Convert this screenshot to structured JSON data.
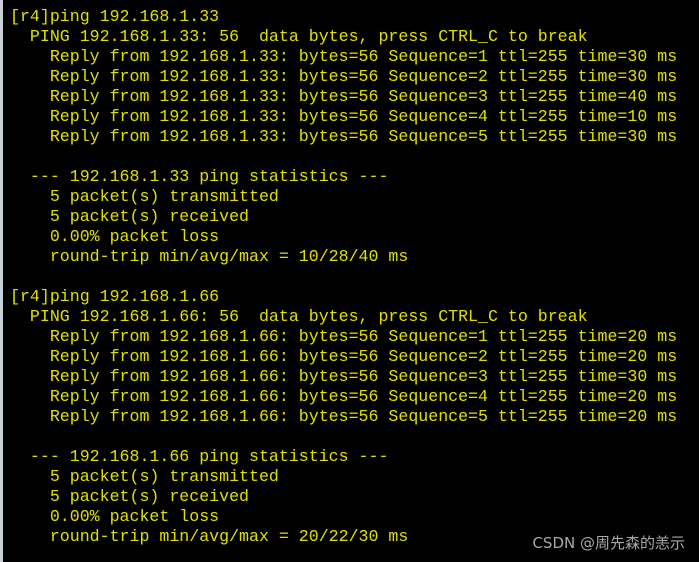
{
  "terminal": {
    "lines": [
      "[r4]ping 192.168.1.33",
      "  PING 192.168.1.33: 56  data bytes, press CTRL_C to break",
      "    Reply from 192.168.1.33: bytes=56 Sequence=1 ttl=255 time=30 ms",
      "    Reply from 192.168.1.33: bytes=56 Sequence=2 ttl=255 time=30 ms",
      "    Reply from 192.168.1.33: bytes=56 Sequence=3 ttl=255 time=40 ms",
      "    Reply from 192.168.1.33: bytes=56 Sequence=4 ttl=255 time=10 ms",
      "    Reply from 192.168.1.33: bytes=56 Sequence=5 ttl=255 time=30 ms",
      "",
      "  --- 192.168.1.33 ping statistics ---",
      "    5 packet(s) transmitted",
      "    5 packet(s) received",
      "    0.00% packet loss",
      "    round-trip min/avg/max = 10/28/40 ms",
      "",
      "[r4]ping 192.168.1.66",
      "  PING 192.168.1.66: 56  data bytes, press CTRL_C to break",
      "    Reply from 192.168.1.66: bytes=56 Sequence=1 ttl=255 time=20 ms",
      "    Reply from 192.168.1.66: bytes=56 Sequence=2 ttl=255 time=20 ms",
      "    Reply from 192.168.1.66: bytes=56 Sequence=3 ttl=255 time=30 ms",
      "    Reply from 192.168.1.66: bytes=56 Sequence=4 ttl=255 time=20 ms",
      "    Reply from 192.168.1.66: bytes=56 Sequence=5 ttl=255 time=20 ms",
      "",
      "  --- 192.168.1.66 ping statistics ---",
      "    5 packet(s) transmitted",
      "    5 packet(s) received",
      "    0.00% packet loss",
      "    round-trip min/avg/max = 20/22/30 ms"
    ],
    "text_color": "#e0e000",
    "background": "#000000"
  },
  "watermark": "CSDN @周先森的恙示"
}
